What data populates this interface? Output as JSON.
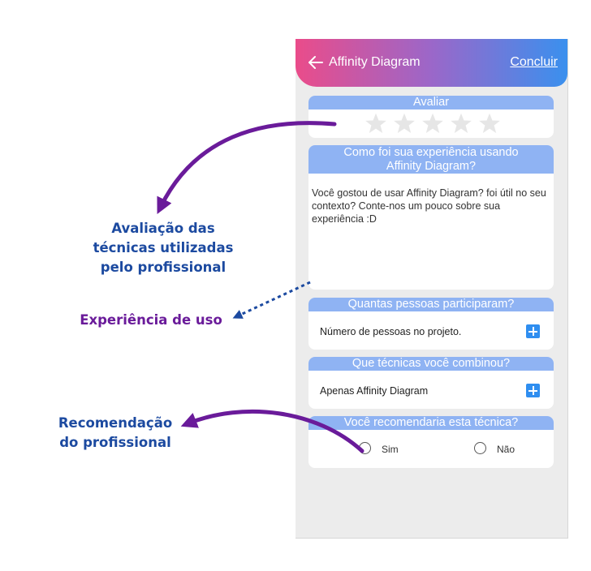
{
  "app": {
    "title": "Affinity Diagram",
    "done_label": "Concluir"
  },
  "rating": {
    "header": "Avaliar",
    "max_stars": 5,
    "value": 0
  },
  "experience": {
    "header_line1": "Como foi sua experiência usando",
    "header_line2": "Affinity Diagram?",
    "text": "Você gostou de usar Affinity Diagram? foi útil no seu contexto? Conte-nos um pouco sobre sua experiência :D"
  },
  "participants": {
    "header": "Quantas pessoas participaram?",
    "value": "Número de pessoas no projeto."
  },
  "techniques": {
    "header": "Que técnicas você combinou?",
    "value": "Apenas Affinity Diagram"
  },
  "recommend": {
    "header": "Você recomendaria esta técnica?",
    "option_yes": "Sim",
    "option_no": "Não"
  },
  "annotations": {
    "rating_line1": "Avaliação das",
    "rating_line2": "técnicas utilizadas",
    "rating_line3": "pelo profissional",
    "experience": "Experiência de uso",
    "recommend_line1": "Recomendação",
    "recommend_line2": "do profissional"
  },
  "colors": {
    "gradient_start": "#ea4c8a",
    "gradient_end": "#3a90ee",
    "card_header": "#8fb3f3",
    "plus_button": "#2f8ef0",
    "annotation_blue": "#1c4aa0",
    "annotation_purple": "#6a1b9a",
    "star_empty": "#e6e6e6"
  }
}
